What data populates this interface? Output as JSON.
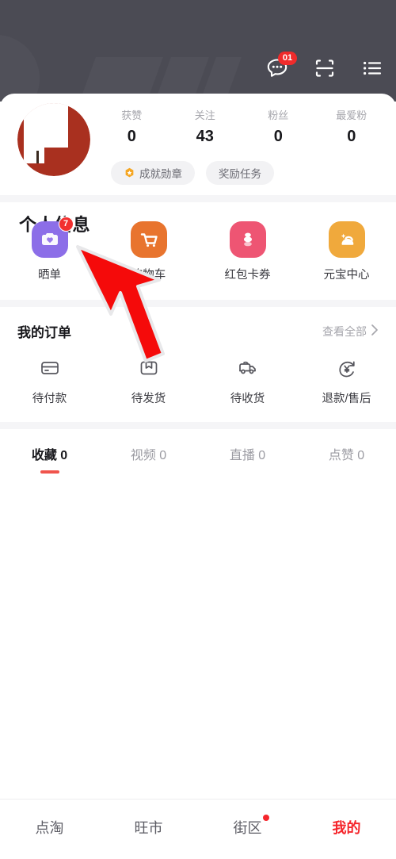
{
  "header": {
    "message_icon": "chat-bubble-icon",
    "message_badge": "01",
    "scan_icon": "scan-icon",
    "menu_icon": "list-menu-icon"
  },
  "profile": {
    "avatar_name": "user-avatar",
    "stats": [
      {
        "label": "获赞",
        "value": "0"
      },
      {
        "label": "关注",
        "value": "43"
      },
      {
        "label": "粉丝",
        "value": "0"
      },
      {
        "label": "最爱粉",
        "value": "0"
      }
    ],
    "chips": [
      {
        "label": "成就勋章",
        "icon": "medal-hexagon-icon"
      },
      {
        "label": "奖励任务",
        "icon": ""
      }
    ],
    "page_title": "个人信息"
  },
  "quick_grid": [
    {
      "label": "晒单",
      "icon": "camera-heart-icon",
      "badge": "7",
      "color": "#8c6ee8"
    },
    {
      "label": "购物车",
      "icon": "shopping-cart-icon",
      "badge": "",
      "color": "#e8742e"
    },
    {
      "label": "红包卡券",
      "icon": "ingot-coupon-icon",
      "badge": "",
      "color": "#ee5573"
    },
    {
      "label": "元宝中心",
      "icon": "gold-ingot-icon",
      "badge": "",
      "color": "#f0a93c"
    }
  ],
  "orders": {
    "title": "我的订单",
    "view_all": "查看全部",
    "view_all_icon": "chevron-right-icon",
    "items": [
      {
        "label": "待付款",
        "icon": "wallet-card-icon"
      },
      {
        "label": "待发货",
        "icon": "package-box-icon"
      },
      {
        "label": "待收货",
        "icon": "delivery-truck-icon"
      },
      {
        "label": "退款/售后",
        "icon": "refund-yen-icon"
      }
    ]
  },
  "tabs": [
    {
      "label": "收藏 0",
      "active": true
    },
    {
      "label": "视频 0",
      "active": false
    },
    {
      "label": "直播 0",
      "active": false
    },
    {
      "label": "点赞 0",
      "active": false
    }
  ],
  "bottom_nav": [
    {
      "label": "点淘",
      "active": false,
      "dot": false
    },
    {
      "label": "旺市",
      "active": false,
      "dot": false
    },
    {
      "label": "街区",
      "active": false,
      "dot": true
    },
    {
      "label": "我的",
      "active": true,
      "dot": false
    }
  ],
  "annotation": {
    "cursor_icon": "red-arrow-pointer"
  },
  "colors": {
    "header_bg": "#4b4b54",
    "accent_red": "#f5262c",
    "tab_underline": "#f0544c",
    "badge_red": "#f02b2b",
    "muted_text": "#a6a6ac"
  }
}
